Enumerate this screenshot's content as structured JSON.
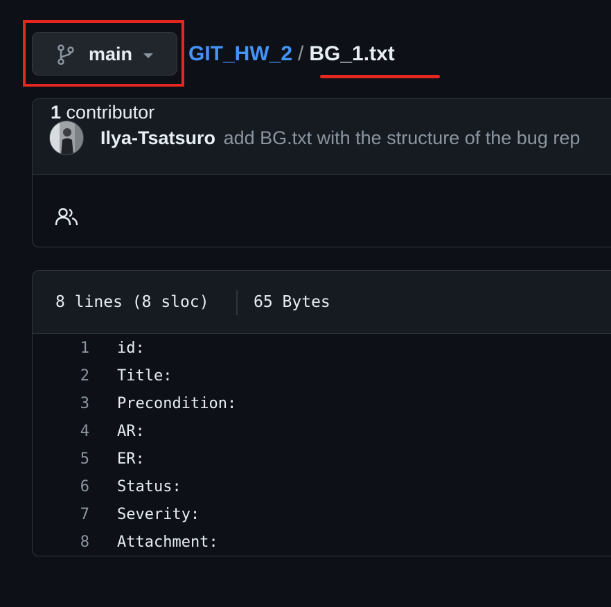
{
  "branch": {
    "name": "main",
    "icon": "git-branch-icon",
    "caret_icon": "triangle-down-icon"
  },
  "breadcrumb": {
    "repo": "GIT_HW_2",
    "separator": "/",
    "file": "BG_1.txt"
  },
  "commit": {
    "avatar_icon": "avatar",
    "author": "Ilya-Tsatsuro",
    "message": "add BG.txt with the structure of the bug rep"
  },
  "contributors": {
    "icon": "people-icon",
    "count": "1",
    "label": "contributor"
  },
  "file_info": {
    "lines": "8 lines (8 sloc)",
    "size": "65 Bytes"
  },
  "code": [
    {
      "num": "1",
      "text": "id:"
    },
    {
      "num": "2",
      "text": "Title:"
    },
    {
      "num": "3",
      "text": "Precondition:"
    },
    {
      "num": "4",
      "text": "AR:"
    },
    {
      "num": "5",
      "text": "ER:"
    },
    {
      "num": "6",
      "text": "Status:"
    },
    {
      "num": "7",
      "text": "Severity:"
    },
    {
      "num": "8",
      "text": "Attachment:"
    }
  ],
  "colors": {
    "background": "#0d1117",
    "link": "#4493f8",
    "highlight": "#e5271f",
    "muted": "#8d96a0"
  }
}
